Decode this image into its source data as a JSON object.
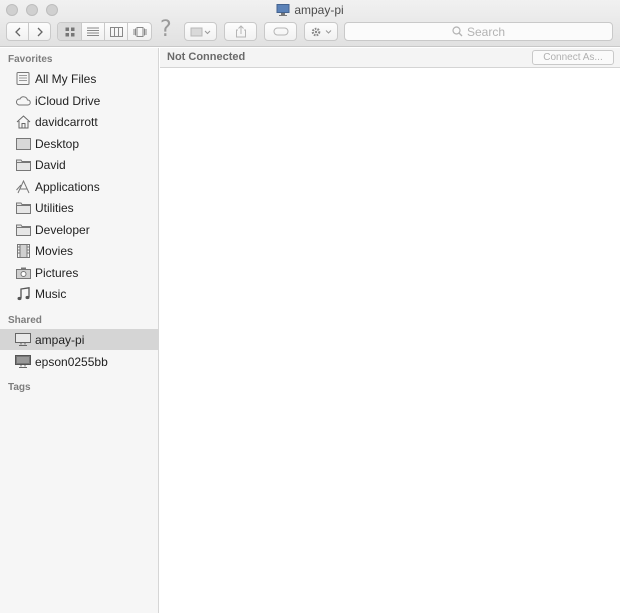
{
  "window": {
    "title": "ampay-pi"
  },
  "toolbar": {
    "search_placeholder": "Search",
    "help_glyph": "?"
  },
  "sidebar": {
    "favorites_header": "Favorites",
    "favorites": [
      {
        "label": "All My Files",
        "icon": "all-files-icon"
      },
      {
        "label": "iCloud Drive",
        "icon": "cloud-icon"
      },
      {
        "label": "davidcarrott",
        "icon": "home-icon"
      },
      {
        "label": "Desktop",
        "icon": "desktop-icon"
      },
      {
        "label": "David",
        "icon": "folder-icon"
      },
      {
        "label": "Applications",
        "icon": "applications-icon"
      },
      {
        "label": "Utilities",
        "icon": "folder-icon"
      },
      {
        "label": "Developer",
        "icon": "folder-icon"
      },
      {
        "label": "Movies",
        "icon": "movies-icon"
      },
      {
        "label": "Pictures",
        "icon": "camera-icon"
      },
      {
        "label": "Music",
        "icon": "music-icon"
      }
    ],
    "shared_header": "Shared",
    "shared": [
      {
        "label": "ampay-pi",
        "icon": "computer-icon",
        "selected": true
      },
      {
        "label": "epson0255bb",
        "icon": "computer-icon",
        "selected": false
      }
    ],
    "tags_header": "Tags"
  },
  "main": {
    "status": "Not Connected",
    "connect_label": "Connect As..."
  }
}
